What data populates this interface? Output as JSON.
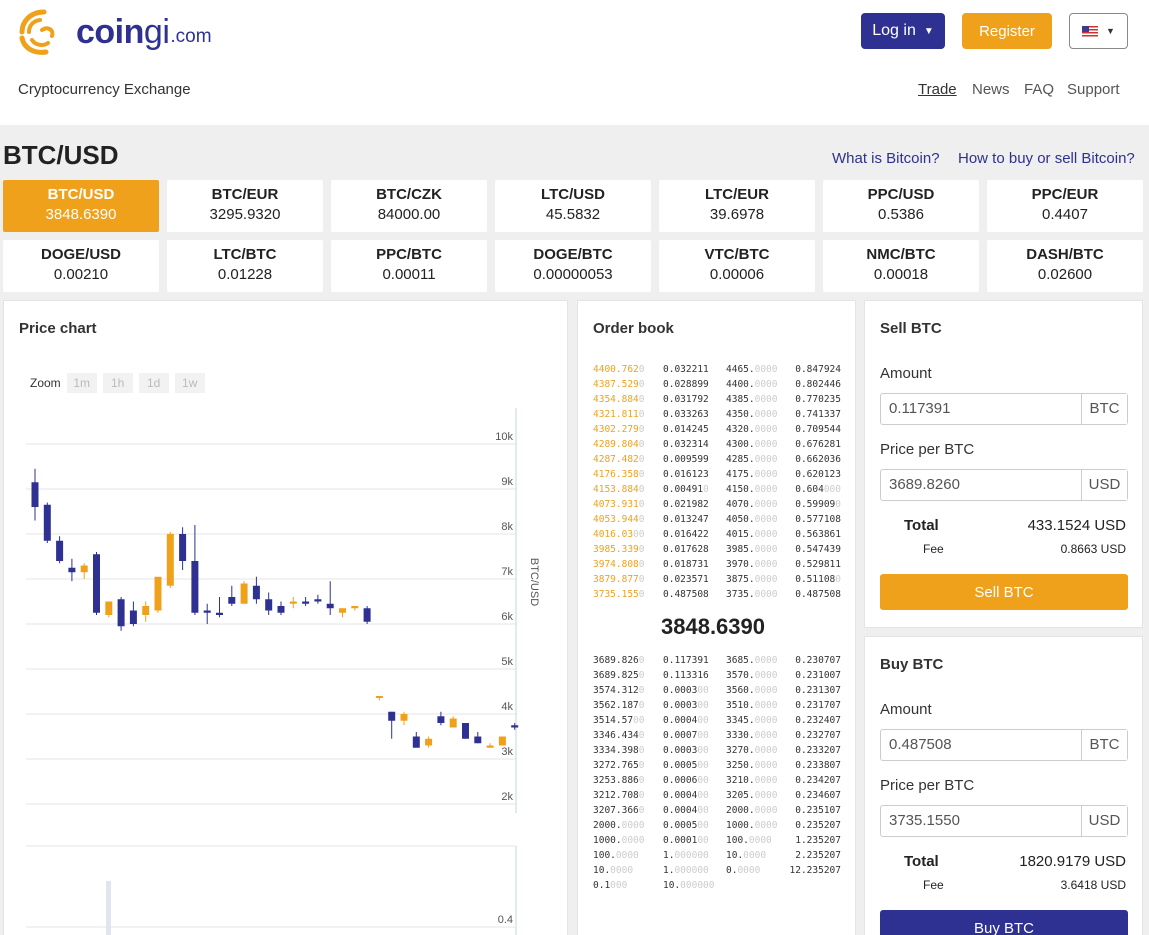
{
  "brand": {
    "name_main": "coin",
    "name_accent": "gi",
    "domain": ".com",
    "tagline": "Cryptocurrency Exchange"
  },
  "header": {
    "login_label": "Log in",
    "register_label": "Register",
    "nav": [
      "Trade",
      "News",
      "FAQ",
      "Support"
    ]
  },
  "pair": {
    "title": "BTC/USD",
    "link_what": "What is Bitcoin?",
    "link_how": "How to buy or sell Bitcoin?"
  },
  "markets": [
    {
      "name": "BTC/USD",
      "price": "3848.6390",
      "active": true
    },
    {
      "name": "BTC/EUR",
      "price": "3295.9320"
    },
    {
      "name": "BTC/CZK",
      "price": "84000.00"
    },
    {
      "name": "LTC/USD",
      "price": "45.5832"
    },
    {
      "name": "LTC/EUR",
      "price": "39.6978"
    },
    {
      "name": "PPC/USD",
      "price": "0.5386"
    },
    {
      "name": "PPC/EUR",
      "price": "0.4407"
    },
    {
      "name": "DOGE/USD",
      "price": "0.00210"
    },
    {
      "name": "LTC/BTC",
      "price": "0.01228"
    },
    {
      "name": "PPC/BTC",
      "price": "0.00011"
    },
    {
      "name": "DOGE/BTC",
      "price": "0.00000053"
    },
    {
      "name": "VTC/BTC",
      "price": "0.00006"
    },
    {
      "name": "NMC/BTC",
      "price": "0.00018"
    },
    {
      "name": "DASH/BTC",
      "price": "0.02600"
    }
  ],
  "chart_panel": {
    "title": "Price chart",
    "zoom_label": "Zoom",
    "zoom_buttons": [
      "1m",
      "1h",
      "1d",
      "1w"
    ]
  },
  "chart_data": {
    "type": "candlestick",
    "ylabel": "BTC/USD",
    "y_ticks": [
      "10k",
      "9k",
      "8k",
      "7k",
      "6k",
      "5k",
      "4k",
      "3k",
      "2k"
    ],
    "ylim": [
      1800,
      10800
    ],
    "volume_tick": "0.4",
    "colors": {
      "up": "#f0a11c",
      "down": "#2e3192"
    },
    "candles": [
      {
        "o": 9150,
        "h": 9450,
        "l": 8300,
        "c": 8600
      },
      {
        "o": 8650,
        "h": 8700,
        "l": 7800,
        "c": 7850
      },
      {
        "o": 7850,
        "h": 7950,
        "l": 7350,
        "c": 7400
      },
      {
        "o": 7250,
        "h": 7450,
        "l": 6950,
        "c": 7150
      },
      {
        "o": 7150,
        "h": 7350,
        "l": 7000,
        "c": 7300
      },
      {
        "o": 7550,
        "h": 7600,
        "l": 6200,
        "c": 6250
      },
      {
        "o": 6200,
        "h": 6500,
        "l": 6150,
        "c": 6500
      },
      {
        "o": 6550,
        "h": 6600,
        "l": 5850,
        "c": 5950
      },
      {
        "o": 6300,
        "h": 6500,
        "l": 5950,
        "c": 6000
      },
      {
        "o": 6200,
        "h": 6500,
        "l": 6050,
        "c": 6400
      },
      {
        "o": 6300,
        "h": 6950,
        "l": 6250,
        "c": 7050
      },
      {
        "o": 6850,
        "h": 8050,
        "l": 6800,
        "c": 8000
      },
      {
        "o": 8000,
        "h": 8150,
        "l": 7200,
        "c": 7400
      },
      {
        "o": 7400,
        "h": 8200,
        "l": 6200,
        "c": 6250
      },
      {
        "o": 6300,
        "h": 6450,
        "l": 6000,
        "c": 6250
      },
      {
        "o": 6250,
        "h": 6600,
        "l": 6150,
        "c": 6200
      },
      {
        "o": 6600,
        "h": 6850,
        "l": 6400,
        "c": 6450
      },
      {
        "o": 6450,
        "h": 6950,
        "l": 6450,
        "c": 6900
      },
      {
        "o": 6850,
        "h": 7050,
        "l": 6450,
        "c": 6550
      },
      {
        "o": 6550,
        "h": 6700,
        "l": 6200,
        "c": 6300
      },
      {
        "o": 6400,
        "h": 6500,
        "l": 6200,
        "c": 6250
      },
      {
        "o": 6450,
        "h": 6600,
        "l": 6350,
        "c": 6500
      },
      {
        "o": 6500,
        "h": 6600,
        "l": 6400,
        "c": 6450
      },
      {
        "o": 6550,
        "h": 6650,
        "l": 6450,
        "c": 6500
      },
      {
        "o": 6450,
        "h": 6950,
        "l": 6200,
        "c": 6350
      },
      {
        "o": 6250,
        "h": 6350,
        "l": 6150,
        "c": 6350
      },
      {
        "o": 6350,
        "h": 6400,
        "l": 6300,
        "c": 6400
      },
      {
        "o": 6350,
        "h": 6400,
        "l": 6000,
        "c": 6050
      },
      {
        "o": 4400,
        "h": 4400,
        "l": 4300,
        "c": 4400
      },
      {
        "o": 4050,
        "h": 4050,
        "l": 3450,
        "c": 3850
      },
      {
        "o": 3850,
        "h": 4050,
        "l": 3750,
        "c": 4000
      },
      {
        "o": 3500,
        "h": 3600,
        "l": 3300,
        "c": 3250
      },
      {
        "o": 3300,
        "h": 3500,
        "l": 3250,
        "c": 3450
      },
      {
        "o": 3950,
        "h": 4050,
        "l": 3750,
        "c": 3800
      },
      {
        "o": 3700,
        "h": 3950,
        "l": 3700,
        "c": 3900
      },
      {
        "o": 3800,
        "h": 3800,
        "l": 3450,
        "c": 3450
      },
      {
        "o": 3500,
        "h": 3600,
        "l": 3350,
        "c": 3350
      },
      {
        "o": 3250,
        "h": 3350,
        "l": 3250,
        "c": 3300
      },
      {
        "o": 3300,
        "h": 3500,
        "l": 3300,
        "c": 3500
      },
      {
        "o": 3750,
        "h": 3800,
        "l": 3650,
        "c": 3700
      }
    ]
  },
  "order_book": {
    "title": "Order book",
    "last_price": "3848.6390",
    "asks_left": [
      [
        "4400.7620",
        "0.032211"
      ],
      [
        "4387.5290",
        "0.028899"
      ],
      [
        "4354.8840",
        "0.031792"
      ],
      [
        "4321.8110",
        "0.033263"
      ],
      [
        "4302.2790",
        "0.014245"
      ],
      [
        "4289.8040",
        "0.032314"
      ],
      [
        "4287.4820",
        "0.009599"
      ],
      [
        "4176.3580",
        "0.016123"
      ],
      [
        "4153.8840",
        "0.004910"
      ],
      [
        "4073.9310",
        "0.021982"
      ],
      [
        "4053.9440",
        "0.013247"
      ],
      [
        "4016.0300",
        "0.016422"
      ],
      [
        "3985.3390",
        "0.017628"
      ],
      [
        "3974.8080",
        "0.018731"
      ],
      [
        "3879.8770",
        "0.023571"
      ],
      [
        "3735.1550",
        "0.487508"
      ]
    ],
    "asks_right": [
      [
        "4465.0000",
        "0.847924"
      ],
      [
        "4400.0000",
        "0.802446"
      ],
      [
        "4385.0000",
        "0.770235"
      ],
      [
        "4350.0000",
        "0.741337"
      ],
      [
        "4320.0000",
        "0.709544"
      ],
      [
        "4300.0000",
        "0.676281"
      ],
      [
        "4285.0000",
        "0.662036"
      ],
      [
        "4175.0000",
        "0.620123"
      ],
      [
        "4150.0000",
        "0.604000"
      ],
      [
        "4070.0000",
        "0.599090"
      ],
      [
        "4050.0000",
        "0.577108"
      ],
      [
        "4015.0000",
        "0.563861"
      ],
      [
        "3985.0000",
        "0.547439"
      ],
      [
        "3970.0000",
        "0.529811"
      ],
      [
        "3875.0000",
        "0.511080"
      ],
      [
        "3735.0000",
        "0.487508"
      ]
    ],
    "bids_left": [
      [
        "3689.8260",
        "0.117391"
      ],
      [
        "3689.8250",
        "0.113316"
      ],
      [
        "3574.3120",
        "0.000300"
      ],
      [
        "3562.1870",
        "0.000300"
      ],
      [
        "3514.5700",
        "0.000400"
      ],
      [
        "3346.4340",
        "0.000700"
      ],
      [
        "3334.3980",
        "0.000300"
      ],
      [
        "3272.7650",
        "0.000500"
      ],
      [
        "3253.8860",
        "0.000600"
      ],
      [
        "3212.7080",
        "0.000400"
      ],
      [
        "3207.3660",
        "0.000400"
      ],
      [
        "2000.0000",
        "0.000500"
      ],
      [
        "1000.0000",
        "0.000100"
      ],
      [
        "100.0000",
        "1.000000"
      ],
      [
        "10.0000",
        "1.000000"
      ],
      [
        "0.1000",
        "10.000000"
      ]
    ],
    "bids_right": [
      [
        "3685.0000",
        "0.230707"
      ],
      [
        "3570.0000",
        "0.231007"
      ],
      [
        "3560.0000",
        "0.231307"
      ],
      [
        "3510.0000",
        "0.231707"
      ],
      [
        "3345.0000",
        "0.232407"
      ],
      [
        "3330.0000",
        "0.232707"
      ],
      [
        "3270.0000",
        "0.233207"
      ],
      [
        "3250.0000",
        "0.233807"
      ],
      [
        "3210.0000",
        "0.234207"
      ],
      [
        "3205.0000",
        "0.234607"
      ],
      [
        "2000.0000",
        "0.235107"
      ],
      [
        "1000.0000",
        "0.235207"
      ],
      [
        "100.0000",
        "1.235207"
      ],
      [
        "10.0000",
        "2.235207"
      ],
      [
        "0.0000",
        "12.235207"
      ]
    ]
  },
  "sell": {
    "title": "Sell BTC",
    "amount_label": "Amount",
    "amount": "0.117391",
    "amount_unit": "BTC",
    "price_label": "Price per BTC",
    "price": "3689.8260",
    "price_unit": "USD",
    "total_label": "Total",
    "total": "433.1524 USD",
    "fee_label": "Fee",
    "fee": "0.8663 USD",
    "button": "Sell BTC"
  },
  "buy": {
    "title": "Buy BTC",
    "amount_label": "Amount",
    "amount": "0.487508",
    "amount_unit": "BTC",
    "price_label": "Price per BTC",
    "price": "3735.1550",
    "price_unit": "USD",
    "total_label": "Total",
    "total": "1820.9179 USD",
    "fee_label": "Fee",
    "fee": "3.6418 USD",
    "button": "Buy BTC"
  },
  "colors": {
    "brand_blue": "#2e3192",
    "accent_orange": "#f0a11c"
  }
}
